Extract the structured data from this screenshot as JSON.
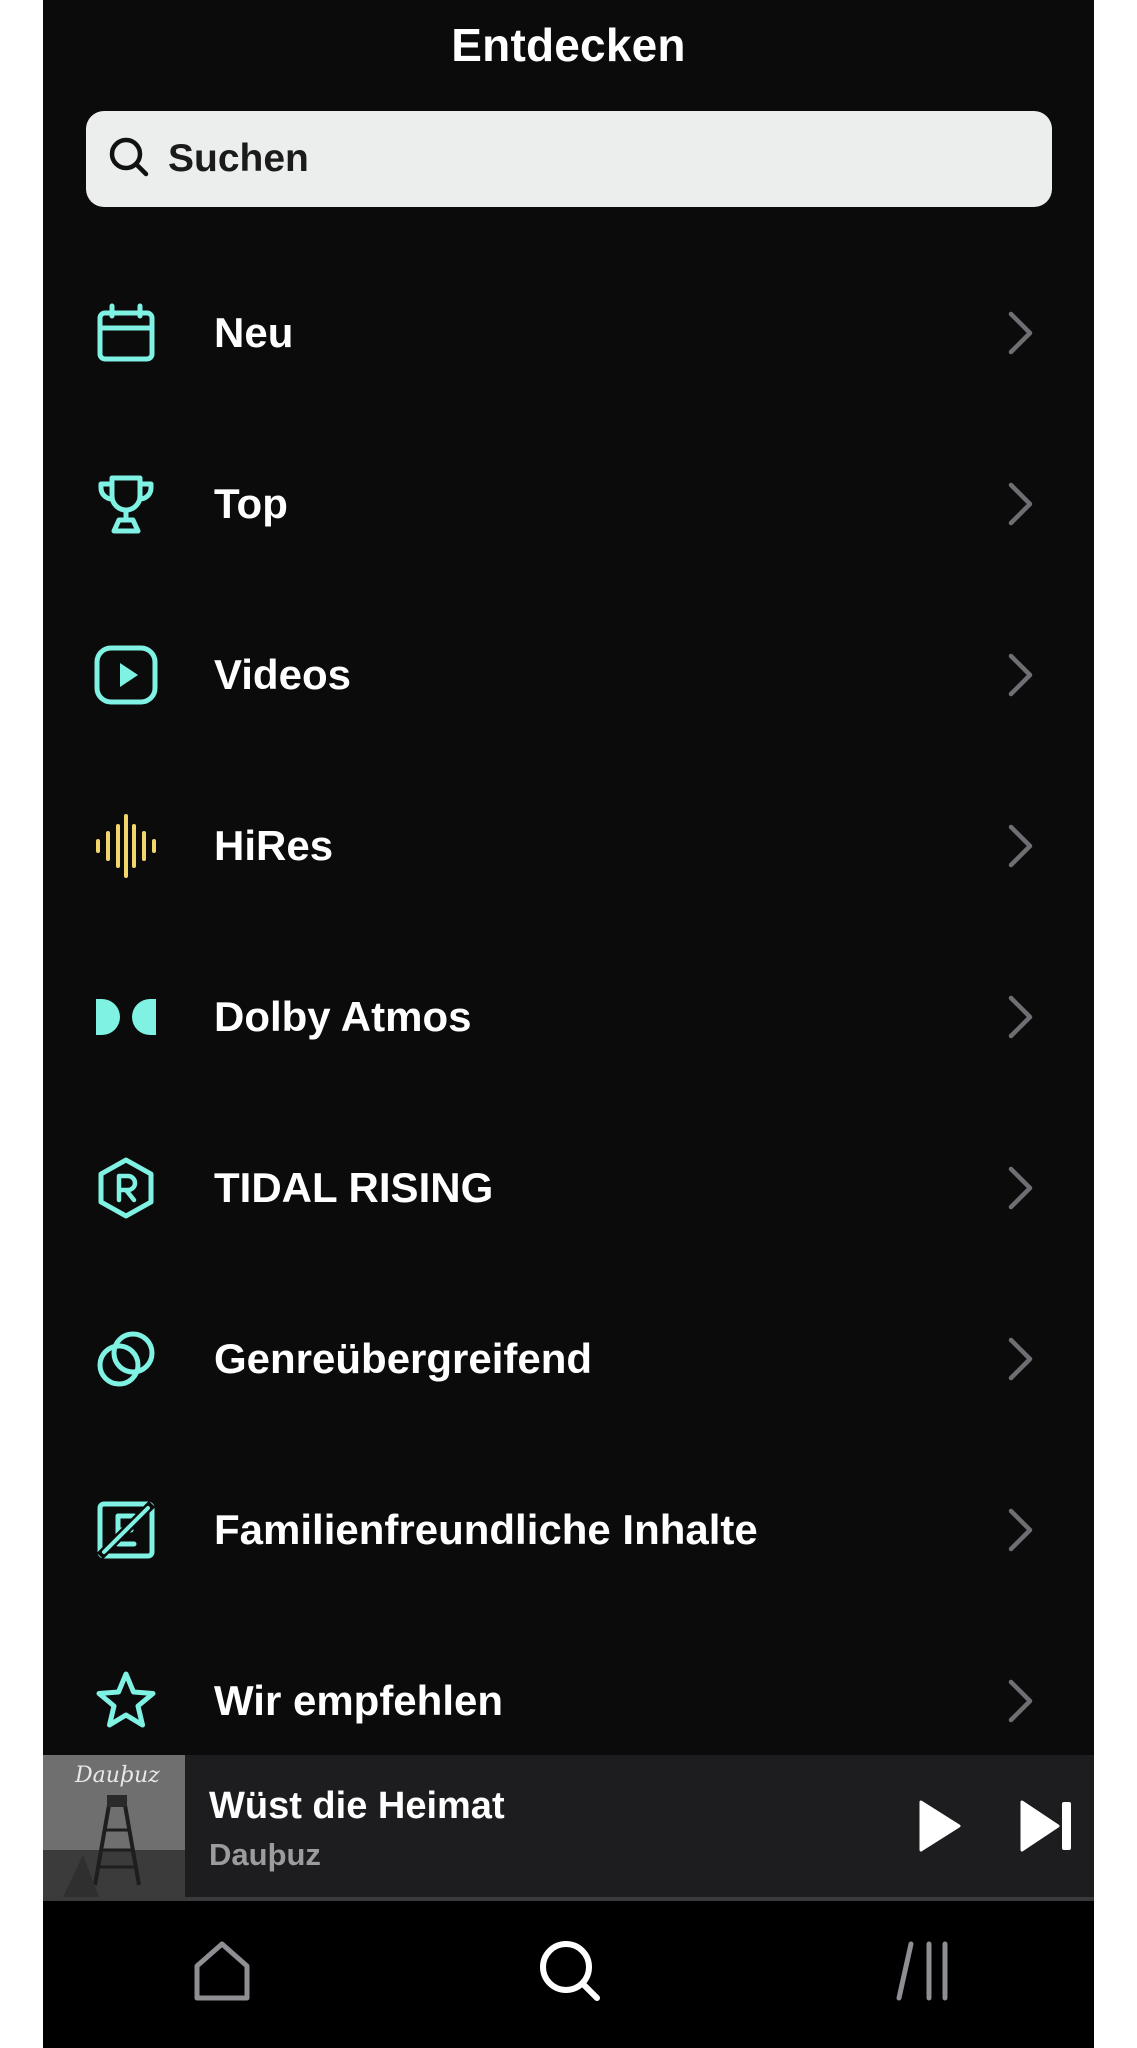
{
  "header": {
    "title": "Entdecken"
  },
  "search": {
    "placeholder": "Suchen",
    "icon": "search-icon"
  },
  "menu": {
    "items": [
      {
        "label": "Neu",
        "icon": "calendar-icon"
      },
      {
        "label": "Top",
        "icon": "trophy-icon"
      },
      {
        "label": "Videos",
        "icon": "video-play-icon"
      },
      {
        "label": "HiRes",
        "icon": "waveform-icon"
      },
      {
        "label": "Dolby Atmos",
        "icon": "dolby-icon"
      },
      {
        "label": "TIDAL RISING",
        "icon": "rising-badge-icon"
      },
      {
        "label": "Genreübergreifend",
        "icon": "interlocking-rings-icon"
      },
      {
        "label": "Familienfreundliche Inhalte",
        "icon": "explicit-off-icon"
      },
      {
        "label": "Wir empfehlen",
        "icon": "star-icon"
      }
    ]
  },
  "now_playing": {
    "title": "Wüst die Heimat",
    "artist": "Dauþuz",
    "cover_text": "Dauþuz",
    "progress": 0.0
  },
  "tabbar": {
    "items": [
      "home-icon",
      "search-icon",
      "collection-icon"
    ]
  },
  "colors": {
    "background": "#0b0b0b",
    "accent_cyan": "#7ff2e4",
    "accent_yellow": "#f2d56b",
    "chevron": "#6e6e73",
    "mini_player": "#1d1d1f",
    "search_field": "#eceeee"
  }
}
